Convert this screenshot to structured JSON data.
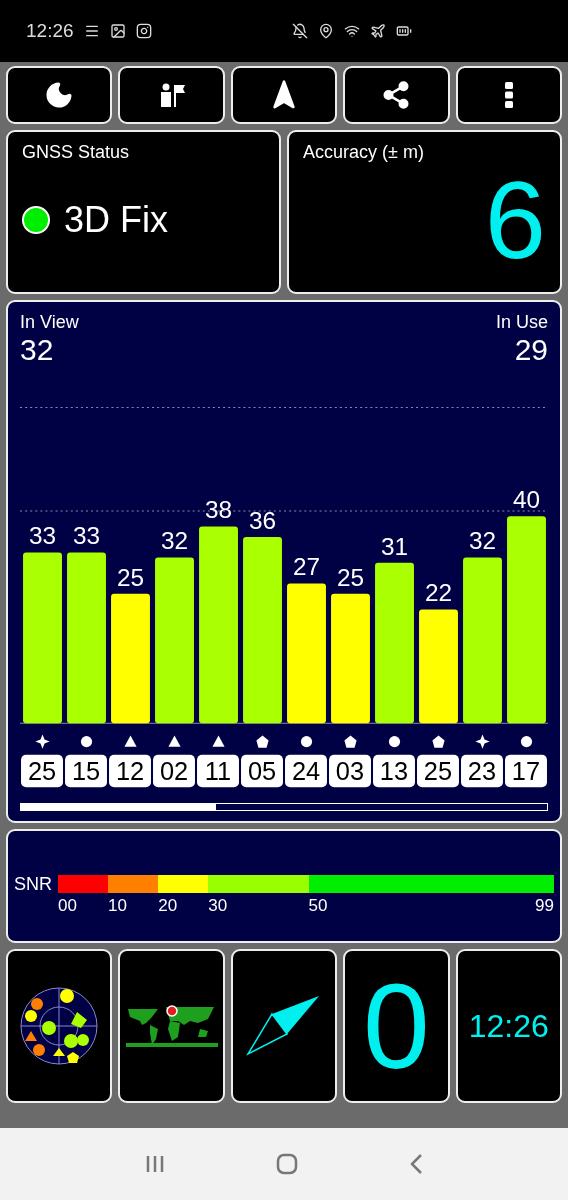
{
  "status_bar": {
    "time": "12:26"
  },
  "gnss_status": {
    "title": "GNSS Status",
    "fix": "3D Fix"
  },
  "accuracy": {
    "title": "Accuracy (± m)",
    "value": "6"
  },
  "satellites": {
    "in_view": {
      "label": "In View",
      "value": "32"
    },
    "in_use": {
      "label": "In Use",
      "value": "29"
    },
    "markers": [
      {
        "kind": "star"
      },
      {
        "kind": "circle"
      },
      {
        "kind": "triangle"
      },
      {
        "kind": "triangle"
      },
      {
        "kind": "triangle"
      },
      {
        "kind": "pentagon"
      },
      {
        "kind": "circle"
      },
      {
        "kind": "pentagon"
      },
      {
        "kind": "circle"
      },
      {
        "kind": "pentagon"
      },
      {
        "kind": "star"
      },
      {
        "kind": "circle"
      }
    ],
    "chart_data": {
      "type": "bar",
      "categories": [
        "25",
        "15",
        "12",
        "02",
        "11",
        "05",
        "24",
        "03",
        "13",
        "25",
        "23",
        "17"
      ],
      "values": [
        33,
        33,
        25,
        32,
        38,
        36,
        27,
        25,
        31,
        22,
        32,
        40
      ],
      "data_labels": true
    }
  },
  "snr_legend": {
    "label": "SNR",
    "ticks": [
      "00",
      "10",
      "20",
      "30",
      "50",
      "99"
    ]
  },
  "tiles": {
    "speed": "0",
    "clock": "12:26"
  }
}
